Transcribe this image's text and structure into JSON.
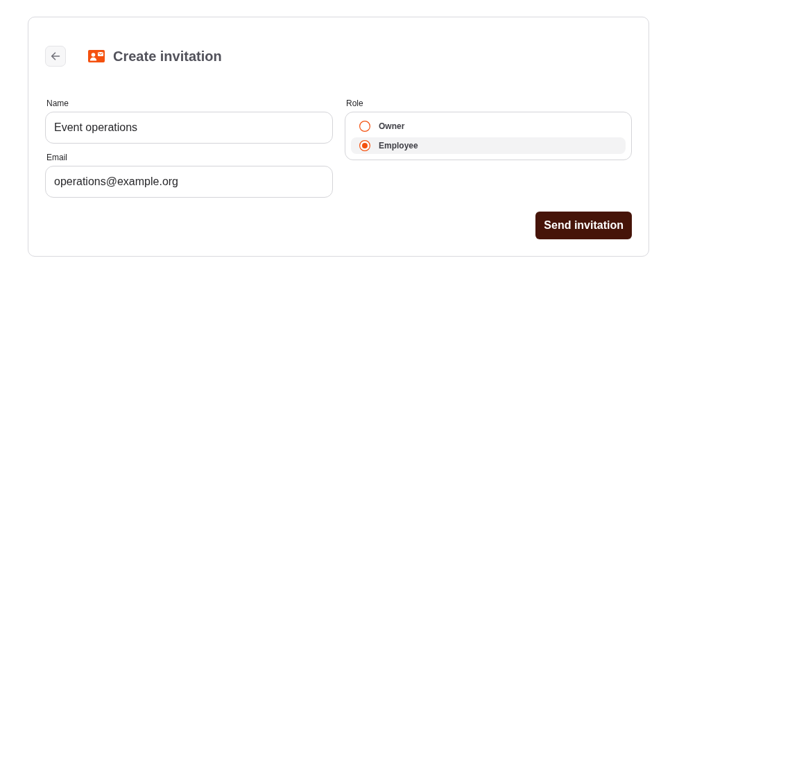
{
  "header": {
    "title": "Create invitation"
  },
  "fields": [
    {
      "label": "Name",
      "value": "Event operations"
    },
    {
      "label": "Email",
      "value": "operations@example.org"
    }
  ],
  "role": {
    "label": "Role",
    "options": [
      {
        "label": "Owner",
        "selected": false
      },
      {
        "label": "Employee",
        "selected": true
      }
    ]
  },
  "submit": {
    "label": "Send invitation"
  }
}
